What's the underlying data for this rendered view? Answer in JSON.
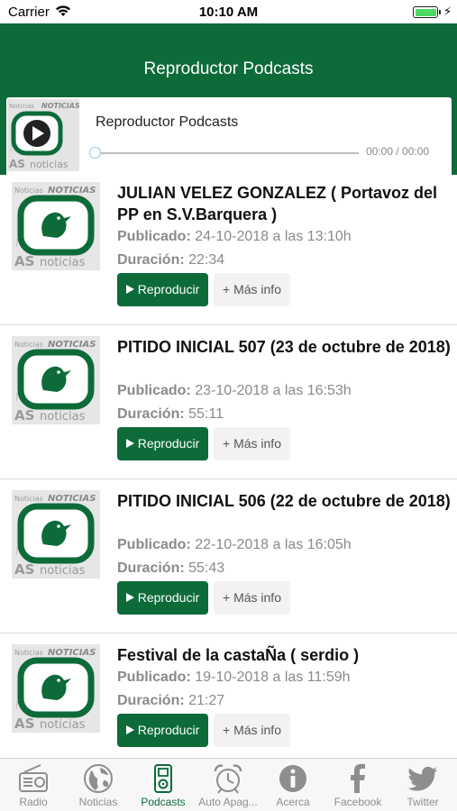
{
  "status_bar": {
    "carrier": "Carrier",
    "time": "10:10 AM",
    "battery_level": 1.0,
    "icons": [
      "wifi-icon",
      "battery-icon",
      "charging-bolt-icon"
    ]
  },
  "header": {
    "title": "Reproductor Podcasts"
  },
  "player": {
    "title": "Reproductor Podcasts",
    "time": "00:00 / 00:00",
    "progress": 0
  },
  "colors": {
    "brand_green": "#0d6b3a",
    "tab_inactive": "#8e8e8e"
  },
  "episodes": [
    {
      "title": "JULIAN VELEZ GONZALEZ ( Portavoz del PP en S.V.Barquera )",
      "published_label": "Publicado:",
      "published": "24-10-2018 a las 13:10h",
      "duration_label": "Duración:",
      "duration": "22:34",
      "play_label": "Reproducir",
      "info_label": "+ Más info"
    },
    {
      "title": "PITIDO INICIAL 507 (23 de octubre de 2018)",
      "published_label": "Publicado:",
      "published": "23-10-2018 a las 16:53h",
      "duration_label": "Duración:",
      "duration": "55:11",
      "play_label": "Reproducir",
      "info_label": "+ Más info"
    },
    {
      "title": "PITIDO INICIAL 506 (22 de octubre de 2018)",
      "published_label": "Publicado:",
      "published": "22-10-2018 a las 16:05h",
      "duration_label": "Duración:",
      "duration": "55:43",
      "play_label": "Reproducir",
      "info_label": "+ Más info"
    },
    {
      "title": "Festival de la castaÑa ( serdio )",
      "published_label": "Publicado:",
      "published": "19-10-2018 a las 11:59h",
      "duration_label": "Duración:",
      "duration": "21:27",
      "play_label": "Reproducir",
      "info_label": "+ Más info"
    }
  ],
  "tabs": [
    {
      "label": "Radio",
      "icon": "radio-icon",
      "active": false
    },
    {
      "label": "Noticias",
      "icon": "globe-icon",
      "active": false
    },
    {
      "label": "Podcasts",
      "icon": "ipod-icon",
      "active": true
    },
    {
      "label": "Auto Apag...",
      "icon": "alarm-clock-icon",
      "active": false
    },
    {
      "label": "Acerca",
      "icon": "info-icon",
      "active": false
    },
    {
      "label": "Facebook",
      "icon": "facebook-icon",
      "active": false
    },
    {
      "label": "Twitter",
      "icon": "twitter-icon",
      "active": false
    }
  ]
}
